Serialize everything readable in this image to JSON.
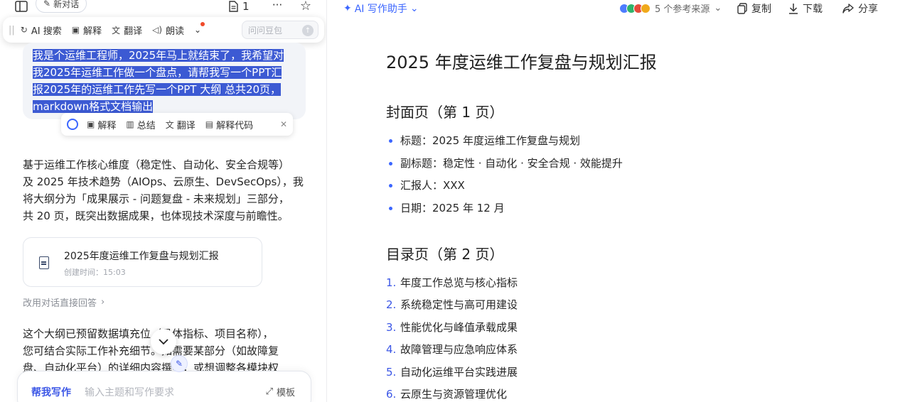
{
  "left": {
    "topbar": {
      "new_chat_label": "新对话",
      "doc_count": "1",
      "more_label": "···",
      "star_label": "☆"
    },
    "ai_toolbar": {
      "items": [
        "AI 搜索",
        "解释",
        "翻译",
        "朗读"
      ],
      "ask_placeholder": "问问豆包"
    },
    "user_message": {
      "lines": [
        "我是个运维工程师，2025年马上就结束了，我希望对",
        "我2025年运维工作做一个盘点，请帮我写一个PPT汇",
        "报2025年的运维工作先写一个PPT 大纲 总共20页，",
        "markdown格式文档输出"
      ]
    },
    "selection_toolbar": {
      "items": [
        "解释",
        "总结",
        "翻译",
        "解释代码"
      ]
    },
    "reply_intro": {
      "lines": [
        "基于运维工作核心维度（稳定性、自动化、安全合规等）",
        "及 2025 年技术趋势（AIOps、云原生、DevSecOps），我",
        "将大纲分为「成果展示 - 问题复盘 - 未来规划」三部分，",
        "共 20 页，既突出数据成果，也体现技术深度与前瞻性。"
      ]
    },
    "doc_card": {
      "title": "2025年度运维工作复盘与规划汇报",
      "created": "创建时间：15:03"
    },
    "switch_link": "改用对话直接回答",
    "reply_outro": {
      "lines": [
        "这个大纲已预留数据填充位（具体指标、项目名称），",
        "您可结合实际工作补充细节。如需要某部分（如故障复",
        "盘、自动化平台）的详细内容撰写，或想调整各模块权"
      ]
    },
    "input_bar": {
      "mode_label": "帮我写作",
      "placeholder": "输入主题和写作要求",
      "template_label": "模板"
    }
  },
  "right": {
    "topbar": {
      "assistant_label": "AI 写作助手",
      "refs_label": "5 个参考来源",
      "copy_label": "复制",
      "download_label": "下载",
      "share_label": "分享"
    },
    "doc": {
      "title": "2025 年度运维工作复盘与规划汇报",
      "sections": [
        {
          "heading": "封面页（第 1 页）",
          "items": [
            "标题：2025 年度运维工作复盘与规划",
            "副标题：稳定性 · 自动化 · 安全合规 · 效能提升",
            "汇报人：XXX",
            "日期：2025 年 12 月"
          ]
        },
        {
          "heading": "目录页（第 2 页）",
          "items": [
            "年度工作总览与核心指标",
            "系统稳定性与高可用建设",
            "性能优化与峰值承载成果",
            "故障管理与应急响应体系",
            "自动化运维平台实践进展",
            "云原生与资源管理优化"
          ]
        }
      ]
    }
  },
  "colors": {
    "accent": "#3b56e6",
    "selection": "#3c5ad3",
    "bullet": "#3b66ff"
  }
}
